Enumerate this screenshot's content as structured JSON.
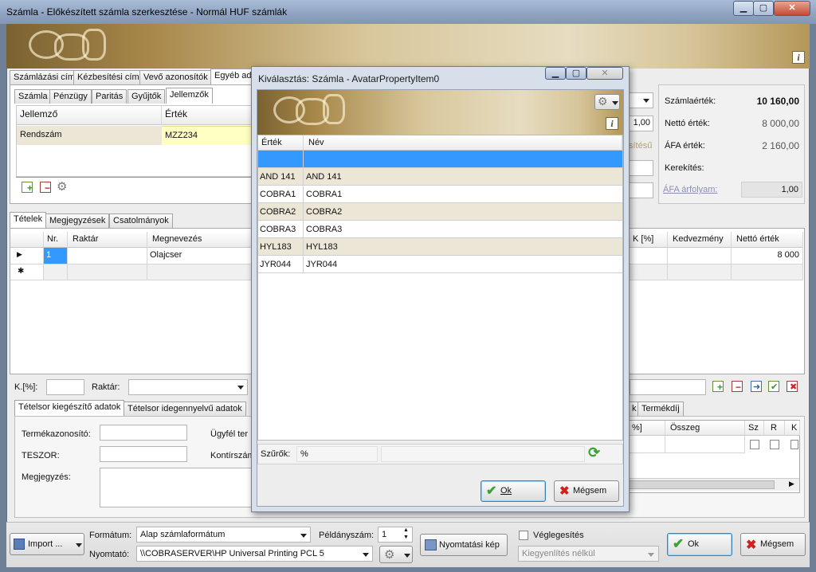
{
  "window": {
    "title": "Számla - Előkészített számla szerkesztése - Normál HUF számlák",
    "minimize": "▁",
    "maximize": "▢",
    "close": "✕"
  },
  "top_tabs": [
    "Számlázási cím",
    "Kézbesítési cím",
    "Vevő azonosítók",
    "Egyéb ad"
  ],
  "sub_tabs": [
    "Számla",
    "Pénzügy",
    "Paritás",
    "Gyűjtők",
    "Jellemzők"
  ],
  "properties": {
    "col_property": "Jellemző",
    "col_value": "Érték",
    "rows": [
      {
        "name": "Rendszám",
        "value": "MZZ234"
      }
    ]
  },
  "right_fields": {
    "value1": "1,00",
    "partial": "sítésű"
  },
  "totals": {
    "invoice_value_label": "Számlaérték:",
    "invoice_value": "10 160,00",
    "net_label": "Nettó érték:",
    "net": "8 000,00",
    "vat_label": "ÁFA érték:",
    "vat": "2 160,00",
    "rounding_label": "Kerekítés:",
    "rate_label": "ÁFA árfolyam:",
    "rate": "1,00"
  },
  "item_tabs": [
    "Tételek",
    "Megjegyzések",
    "Csatolmányok"
  ],
  "items_grid": {
    "col_nr": "Nr.",
    "col_warehouse": "Raktár",
    "col_name": "Megnevezés",
    "col_k": "K [%]",
    "col_discount": "Kedvezmény",
    "col_net": "Nettó érték",
    "row_nr": "1",
    "row_name": "Olajcser",
    "row_net": "8 000",
    "row_marker": "▶",
    "new_row_marker": "✱"
  },
  "item_fields": {
    "k_label": "K.[%]:",
    "warehouse_label": "Raktár:"
  },
  "extra_tabs": [
    "Tételsor kiegészítő adatok",
    "Tételsor idegennyelvű adatok"
  ],
  "right_tabs": [
    "k",
    "Termékdíj"
  ],
  "extra_fields": {
    "product_id": "Termékazonosító:",
    "teszor": "TESZOR:",
    "note": "Megjegyzés:",
    "customer": "Ügyfél ter",
    "contract": "Kontírszám"
  },
  "fee_grid": {
    "col_pct": "%]",
    "col_sum": "Összeg",
    "col_sz": "Sz",
    "col_r": "R",
    "col_k": "K"
  },
  "bottom": {
    "import_label": "Import ...",
    "format_label": "Formátum:",
    "format_value": "Alap számlaformátum",
    "printer_label": "Nyomtató:",
    "printer_value": "\\\\COBRASERVER\\HP Universal Printing PCL 5",
    "copies_label": "Példányszám:",
    "copies_value": "1",
    "print_preview": "Nyomtatási kép",
    "finalize": "Véglegesítés",
    "settlement_placeholder": "Kiegyenlítés nélkül",
    "ok": "Ok",
    "cancel": "Mégsem"
  },
  "dialog": {
    "title": "Kiválasztás: Számla - AvatarPropertyItem0",
    "col_value": "Érték",
    "col_name": "Név",
    "rows": [
      {
        "value": "",
        "name": ""
      },
      {
        "value": "AND 141",
        "name": "AND 141"
      },
      {
        "value": "COBRA1",
        "name": "COBRA1"
      },
      {
        "value": "COBRA2",
        "name": "COBRA2"
      },
      {
        "value": "COBRA3",
        "name": "COBRA3"
      },
      {
        "value": "HYL183",
        "name": "HYL183"
      },
      {
        "value": "JYR044",
        "name": "JYR044"
      }
    ],
    "filter_label": "Szűrők:",
    "filter_value": "%",
    "ok": "Ok",
    "cancel": "Mégsem"
  },
  "colors": {
    "selection": "#3399ff",
    "row_tan": "#ece6d6",
    "accent": "#3c7fb1"
  }
}
